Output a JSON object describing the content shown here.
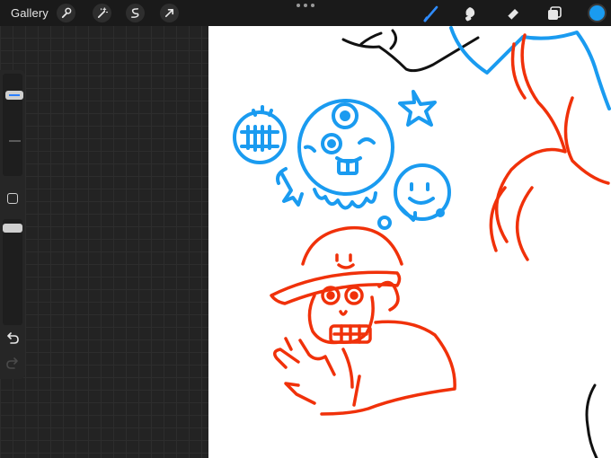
{
  "topbar": {
    "gallery_label": "Gallery",
    "left_tools": [
      "wrench-icon",
      "magic-wand-icon",
      "selection-icon",
      "transform-arrow-icon"
    ],
    "right_tools": [
      "brush-icon",
      "smudge-icon",
      "eraser-icon",
      "layers-icon"
    ],
    "active_tool": "brush-icon",
    "current_color": "#1a9bf0"
  },
  "sidebar": {
    "brush_size_level": 0.18,
    "opacity_level": 0.05,
    "modify_button_icon": "square-icon",
    "undo_icon": "undo-icon",
    "redo_icon": "redo-icon"
  },
  "canvas": {
    "background": "#ffffff",
    "stroke_colors": [
      "#1a9bf0",
      "#f0310a",
      "#000000"
    ]
  }
}
